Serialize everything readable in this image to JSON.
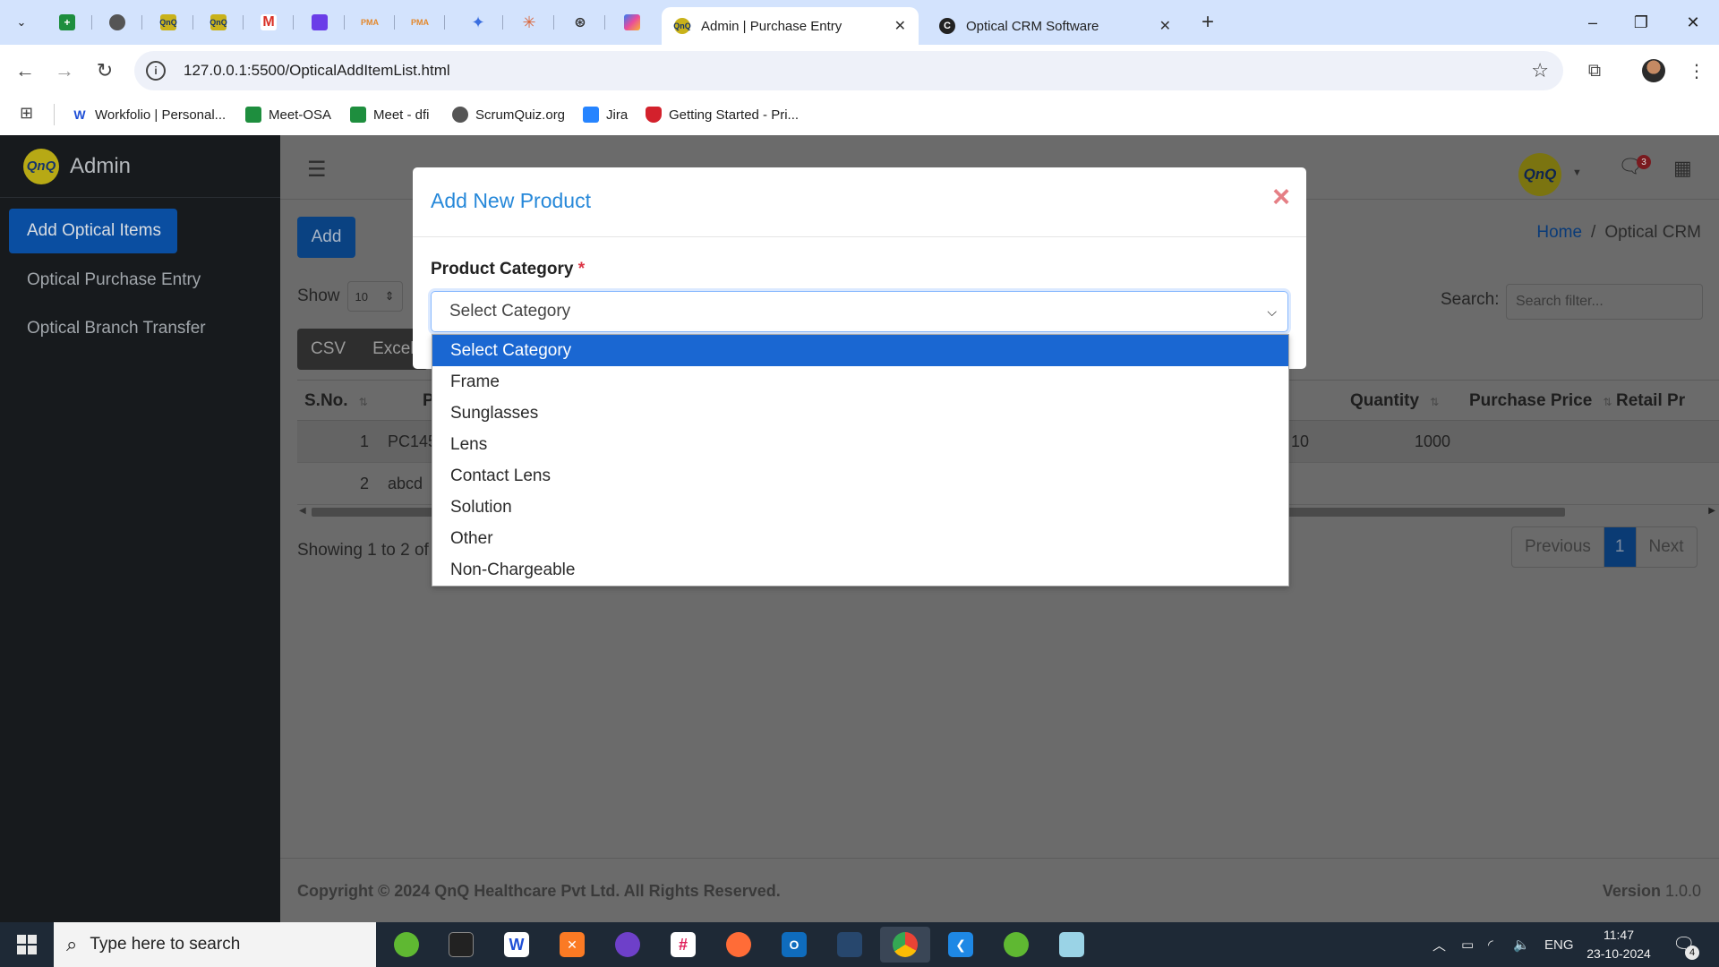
{
  "browser": {
    "tabs": [
      {
        "title": "Admin | Purchase Entry",
        "active": true
      },
      {
        "title": "Optical CRM Software",
        "active": false
      }
    ],
    "url": "127.0.0.1:5500/OpticalAddItemList.html",
    "bookmarks": [
      {
        "label": "Workfolio | Personal...",
        "icon": "workfolio-icon"
      },
      {
        "label": "Meet-OSA",
        "icon": "google-meet-icon"
      },
      {
        "label": "Meet - dfi",
        "icon": "google-meet-icon"
      },
      {
        "label": "ScrumQuiz.org",
        "icon": "globe-icon"
      },
      {
        "label": "Jira",
        "icon": "jira-icon"
      },
      {
        "label": "Getting Started - Pri...",
        "icon": "shield-icon"
      }
    ]
  },
  "sidebar": {
    "brand": "Admin",
    "logo_text": "QnQ",
    "items": [
      {
        "label": "Add Optical Items",
        "active": true
      },
      {
        "label": "Optical Purchase Entry",
        "active": false
      },
      {
        "label": "Optical Branch Transfer",
        "active": false
      }
    ]
  },
  "header": {
    "notification_count": "3"
  },
  "main": {
    "add_label": "Add",
    "breadcrumb": {
      "home": "Home",
      "separator": "/",
      "current": "Optical CRM"
    },
    "show_label": "Show",
    "show_value": "10",
    "search_label": "Search:",
    "search_placeholder": "Search filter...",
    "export_buttons": [
      "CSV",
      "Excel"
    ],
    "table": {
      "headers": [
        {
          "label": "S.No."
        },
        {
          "label": "P"
        },
        {
          "label": "Quantity"
        },
        {
          "label": "Purchase Price"
        },
        {
          "label": "Retail Pr"
        }
      ],
      "rows": [
        {
          "sno": "1",
          "code": "PC145",
          "partial": "10",
          "quantity": "1000",
          "purchase_price": "",
          "retail_price": ""
        },
        {
          "sno": "2",
          "code": "abcd",
          "partial": "",
          "quantity": "",
          "purchase_price": "",
          "retail_price": ""
        }
      ]
    },
    "showing_text": "Showing 1 to 2 of 2",
    "pager": {
      "previous": "Previous",
      "current": "1",
      "next": "Next"
    }
  },
  "footer": {
    "copyright": "Copyright © 2024 QnQ Healthcare Pvt Ltd. All Rights Reserved.",
    "version_label": "Version",
    "version_value": "1.0.0"
  },
  "modal": {
    "title": "Add New Product",
    "close_symbol": "×",
    "field_label": "Product Category",
    "required_mark": "*",
    "select_value": "Select Category",
    "options": [
      "Select Category",
      "Frame",
      "Sunglasses",
      "Lens",
      "Contact Lens",
      "Solution",
      "Other",
      "Non-Chargeable"
    ],
    "selected_index": 0
  },
  "taskbar": {
    "search_placeholder": "Type here to search",
    "language": "ENG",
    "time": "11:47",
    "date": "23-10-2024",
    "notification_count": "4"
  },
  "colors": {
    "accent": "#0a4ea1",
    "modal_title": "#2688d9",
    "close": "#e57f85",
    "selected_option": "#1a67d2",
    "sidebar_bg": "#171a1d",
    "overlay_bg": "#6b6b6b"
  }
}
